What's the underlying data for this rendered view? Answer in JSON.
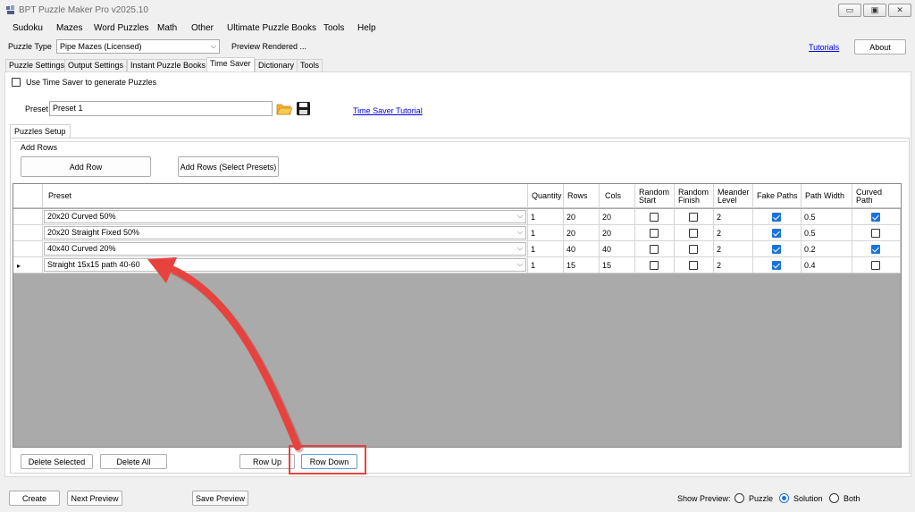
{
  "window": {
    "title": "BPT Puzzle Maker Pro v2025.10",
    "minimize_glyph": "▭",
    "maximize_glyph": "▣",
    "close_glyph": "✕"
  },
  "menu": [
    "Sudoku",
    "Mazes",
    "Word Puzzles",
    "Math",
    "Other",
    "Ultimate Puzzle Books",
    "Tools",
    "Help"
  ],
  "toolbar": {
    "puzzle_type_label": "Puzzle Type",
    "puzzle_type_value": "Pipe Mazes (Licensed)",
    "preview_status": "Preview Rendered ...",
    "tutorials_link": "Tutorials",
    "about_label": "About"
  },
  "tabs": [
    "Puzzle Settings",
    "Output Settings",
    "Instant Puzzle Books",
    "Time Saver",
    "Dictionary",
    "Tools"
  ],
  "active_tab": "Time Saver",
  "time_saver": {
    "use_checkbox_label": "Use Time Saver to generate Puzzles",
    "preset_label": "Preset",
    "preset_value": "Preset 1",
    "tutorial_link": "Time Saver Tutorial",
    "inner_tab": "Puzzles Setup",
    "add_rows_group": "Add Rows",
    "add_row_button": "Add Row",
    "add_rows_presets_button": "Add Rows (Select Presets)"
  },
  "grid": {
    "headers": {
      "preset": "Preset",
      "quantity": "Quantity",
      "rows": "Rows",
      "cols": "Cols",
      "random_start": "Random Start",
      "random_finish": "Random Finish",
      "meander": "Meander Level",
      "fake_paths": "Fake Paths",
      "path_width": "Path Width",
      "curved_path": "Curved Path"
    },
    "current_row_marker": "▸",
    "rows": [
      {
        "preset": "20x20 Curved 50%",
        "quantity": "1",
        "rows": "20",
        "cols": "20",
        "random_start": false,
        "random_finish": false,
        "meander": "2",
        "fake_paths": true,
        "path_width": "0.5",
        "curved_path": true
      },
      {
        "preset": "20x20 Straight Fixed 50%",
        "quantity": "1",
        "rows": "20",
        "cols": "20",
        "random_start": false,
        "random_finish": false,
        "meander": "2",
        "fake_paths": true,
        "path_width": "0.5",
        "curved_path": false
      },
      {
        "preset": "40x40 Curved 20%",
        "quantity": "1",
        "rows": "40",
        "cols": "40",
        "random_start": false,
        "random_finish": false,
        "meander": "2",
        "fake_paths": true,
        "path_width": "0.2",
        "curved_path": true
      },
      {
        "preset": "Straight 15x15 path 40-60",
        "quantity": "1",
        "rows": "15",
        "cols": "15",
        "random_start": false,
        "random_finish": false,
        "meander": "2",
        "fake_paths": true,
        "path_width": "0.4",
        "curved_path": false
      }
    ]
  },
  "grid_actions": {
    "delete_selected": "Delete Selected",
    "delete_all": "Delete All",
    "row_up": "Row Up",
    "row_down": "Row Down"
  },
  "bottom": {
    "create": "Create",
    "next_preview": "Next Preview",
    "save_preview": "Save Preview",
    "show_preview_label": "Show Preview:",
    "options": [
      "Puzzle",
      "Solution",
      "Both"
    ],
    "selected_option": "Solution"
  },
  "colors": {
    "annotation_red": "#e8423f",
    "check_blue": "#1a73d9",
    "link_blue": "#0000ee"
  }
}
